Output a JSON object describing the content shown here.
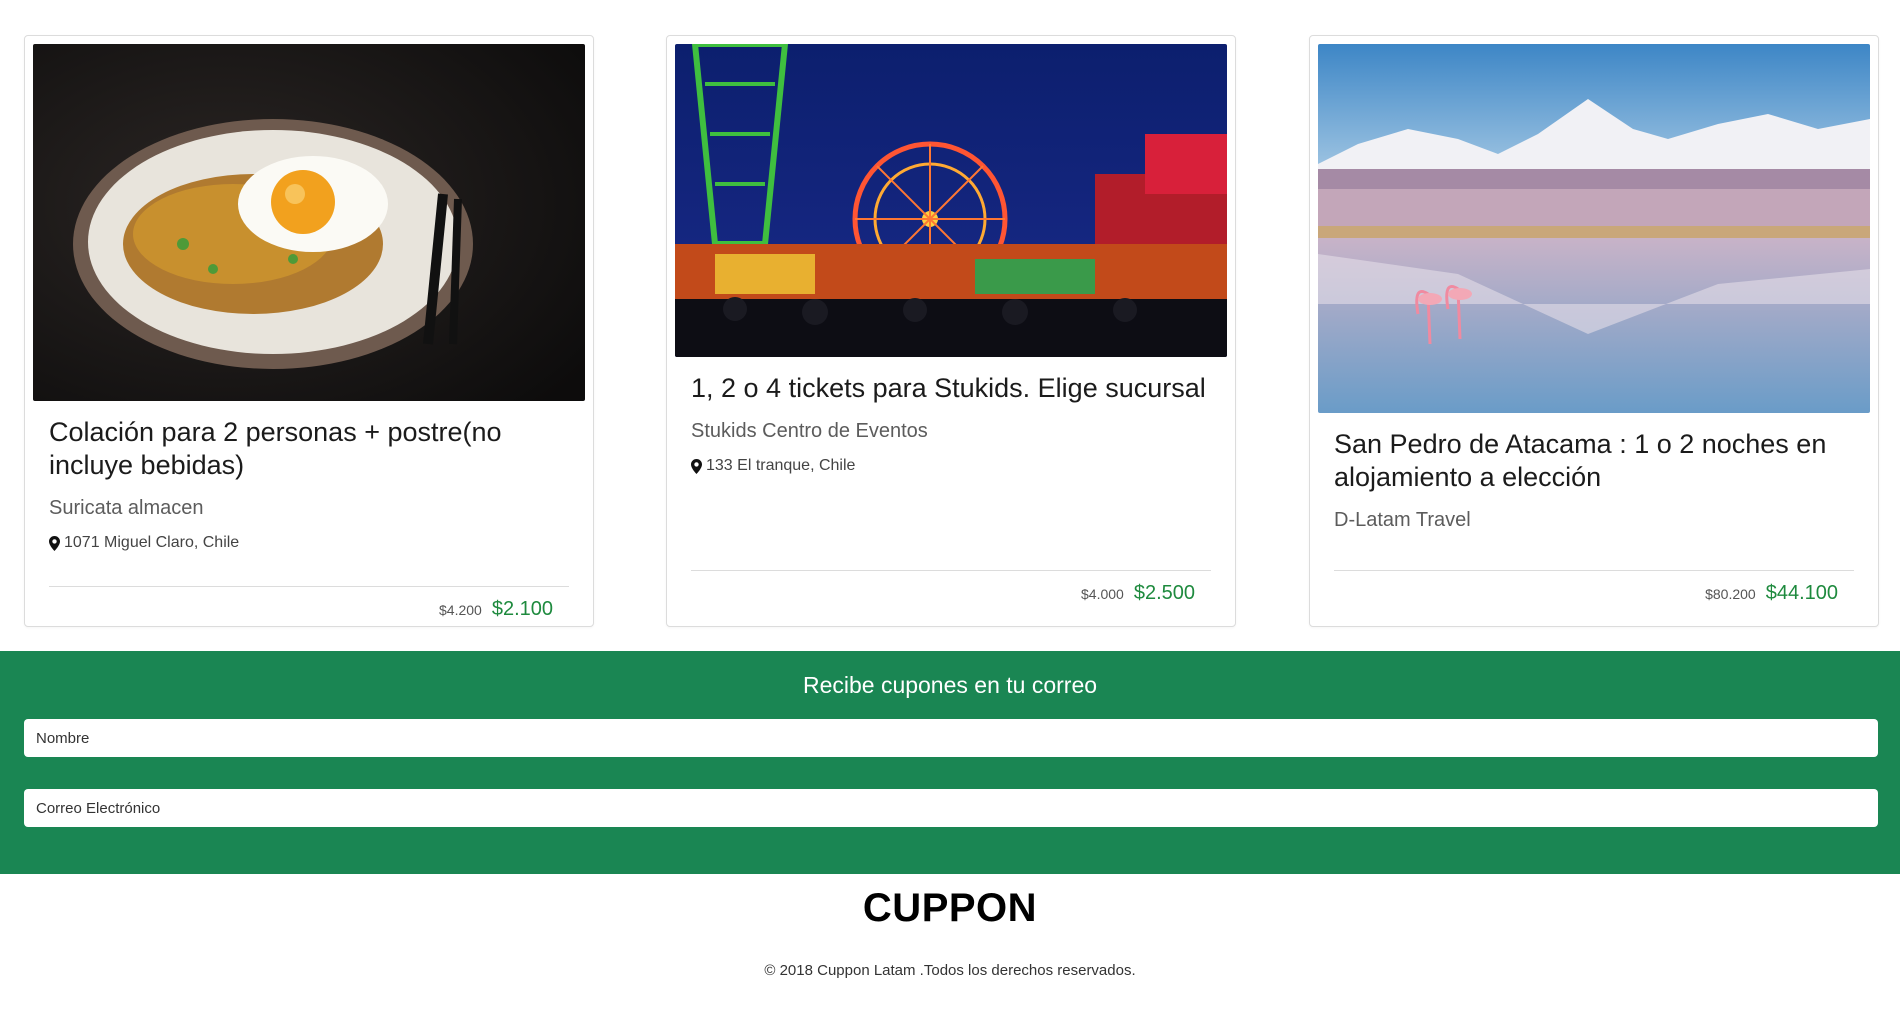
{
  "deals": [
    {
      "title": "Colación para 2 personas + postre(no incluye bebidas)",
      "vendor": "Suricata almacen",
      "location": "1071 Miguel Claro, Chile",
      "old_price": "$4.200",
      "new_price": "$2.100",
      "image": "plate-of-food-with-fried-egg"
    },
    {
      "title": "1, 2 o 4 tickets para Stukids. Elige sucursal",
      "vendor": "Stukids Centro de Eventos",
      "location": "133 El tranque, Chile",
      "old_price": "$4.000",
      "new_price": "$2.500",
      "image": "night-amusement-park-with-ferris-wheel"
    },
    {
      "title": "San Pedro de Atacama : 1 o 2 noches en alojamiento a elección",
      "vendor": "D-Latam Travel",
      "old_price": "$80.200",
      "new_price": "$44.100",
      "image": "snowy-volcano-reflected-in-lagoon-with-flamingos"
    }
  ],
  "newsletter": {
    "title": "Recibe cupones en tu correo",
    "name_placeholder": "Nombre",
    "email_placeholder": "Correo Electrónico"
  },
  "footer": {
    "brand": "CUPPON",
    "copyright": "© 2018 Cuppon Latam .Todos los derechos reservados."
  },
  "colors": {
    "accent_green": "#1a8653",
    "price_green": "#1e8a3e"
  }
}
